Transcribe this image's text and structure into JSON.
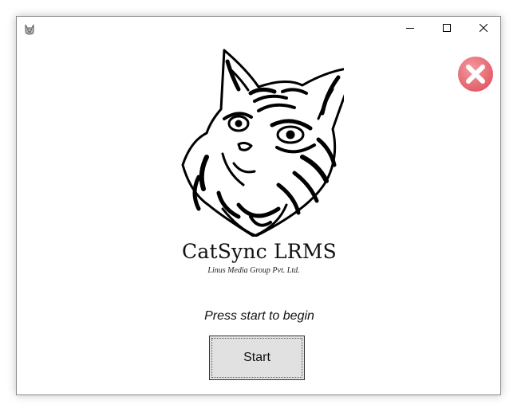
{
  "titlebar": {
    "app_icon": "cat-icon",
    "controls": {
      "minimize_icon": "minimize-icon",
      "maximize_icon": "maximize-icon",
      "close_icon": "close-icon"
    }
  },
  "exit_button": {
    "icon": "red-circle-x-icon",
    "color": "#e8606a"
  },
  "logo": {
    "icon": "tribal-cat-head-icon"
  },
  "app": {
    "title": "CatSync LRMS",
    "company": "Linus Media Group Pvt. Ltd."
  },
  "prompt": "Press start to begin",
  "start_button": {
    "label": "Start"
  }
}
